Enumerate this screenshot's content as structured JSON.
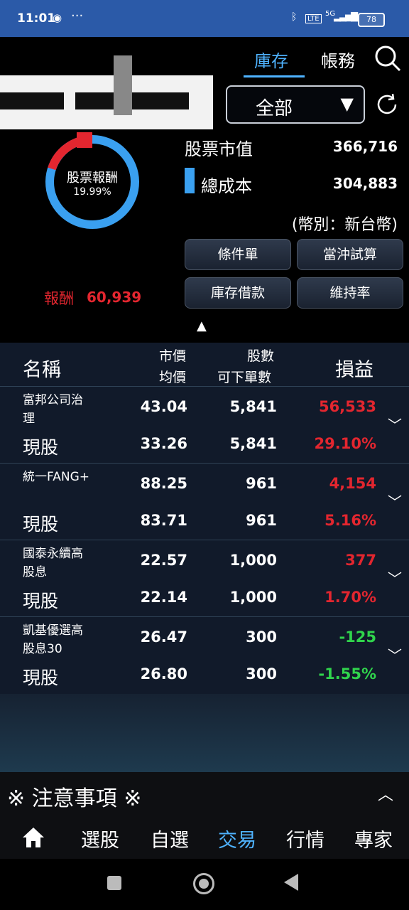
{
  "status_bar": {
    "time": "11:01",
    "battery": "78",
    "indicators": "5G"
  },
  "tabs": [
    {
      "label": "庫存",
      "active": true
    },
    {
      "label": "帳務",
      "active": false
    }
  ],
  "filter": {
    "selected": "全部"
  },
  "donut": {
    "label": "股票報酬",
    "percent": "19.99%",
    "reward_label": "報酬",
    "reward_value": "60,939",
    "fraction": 0.1999
  },
  "summary": {
    "market_value_label": "股票市值",
    "market_value": "366,716",
    "total_cost_label": "總成本",
    "total_cost": "304,883",
    "currency": "(幣別：新台幣)"
  },
  "buttons": {
    "conditional": "條件單",
    "day_trade": "當沖試算",
    "loan": "庫存借款",
    "maintenance": "維持率"
  },
  "table_header": {
    "name": "名稱",
    "market_price": "市價",
    "avg_price": "均價",
    "shares": "股數",
    "sellable": "可下單數",
    "pnl": "損益"
  },
  "rows": [
    {
      "name_l1": "富邦公司治",
      "name_l2": "理",
      "type": "現股",
      "price": "43.04",
      "avg": "33.26",
      "shares": "5,841",
      "sellable": "5,841",
      "pnl": "56,533",
      "pct": "29.10%",
      "sign": "red"
    },
    {
      "name_l1": "統一FANG+",
      "name_l2": "",
      "type": "現股",
      "price": "88.25",
      "avg": "83.71",
      "shares": "961",
      "sellable": "961",
      "pnl": "4,154",
      "pct": "5.16%",
      "sign": "red"
    },
    {
      "name_l1": "國泰永續高",
      "name_l2": "股息",
      "type": "現股",
      "price": "22.57",
      "avg": "22.14",
      "shares": "1,000",
      "sellable": "1,000",
      "pnl": "377",
      "pct": "1.70%",
      "sign": "red"
    },
    {
      "name_l1": "凱基優選高",
      "name_l2": "股息30",
      "type": "現股",
      "price": "26.47",
      "avg": "26.80",
      "shares": "300",
      "sellable": "300",
      "pnl": "-125",
      "pct": "-1.55%",
      "sign": "green"
    }
  ],
  "notice": {
    "label": "※ 注意事項 ※"
  },
  "bottom_nav": [
    "選股",
    "自選",
    "交易",
    "行情",
    "專家"
  ],
  "active_nav": "交易",
  "colors": {
    "accent": "#4fb3ff",
    "profit": "#e3262f",
    "loss": "#30d44c",
    "donut_blue": "#3aa0f0"
  }
}
